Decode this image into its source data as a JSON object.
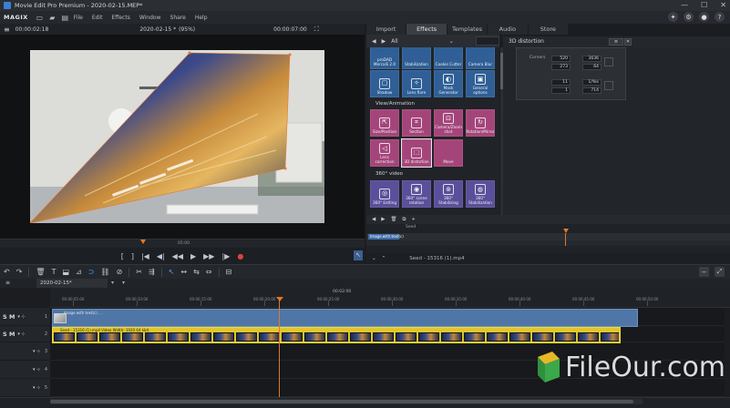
{
  "window": {
    "title": "Movie Edit Pro Premium - 2020-02-15.MEP*",
    "controls": [
      "—",
      "☐",
      "✕"
    ]
  },
  "menu": {
    "logo": "MAGIX",
    "items": [
      "File",
      "Edit",
      "Effects",
      "Window",
      "Share",
      "Help"
    ],
    "right_icons": [
      "magic-wand-icon",
      "gear-icon",
      "record-icon",
      "help-icon"
    ]
  },
  "preview": {
    "timecode_left": "00:00:02:18",
    "project_label": "2020-02-15 *",
    "zoom": "(95%)",
    "timecode_right": "00:00:07:00",
    "ruler_label": "05:00"
  },
  "panel_tabs": [
    "Import",
    "Effects",
    "Templates",
    "Audio",
    "Store"
  ],
  "active_tab": "Effects",
  "filter": {
    "label": "All"
  },
  "effects": {
    "row1": [
      {
        "name": "Shadow",
        "color": "#2f5f96",
        "icon": "shadow-icon"
      },
      {
        "name": "Lens flare",
        "color": "#2f5f96",
        "icon": "lens-flare-icon"
      },
      {
        "name": "Mask Generator",
        "color": "#2f5f96",
        "icon": "mask-icon"
      },
      {
        "name": "General options",
        "color": "#2f5f96",
        "icon": "options-icon"
      }
    ],
    "row0": [
      {
        "name": "proDAD Mercalli 2.0",
        "color": "#2f5f96"
      },
      {
        "name": "Stabilization",
        "color": "#2f5f96"
      },
      {
        "name": "Cookie Cutter",
        "color": "#2f5f96"
      },
      {
        "name": "Camera Blur",
        "color": "#2f5f96"
      }
    ],
    "category_view": "View/Animation",
    "row2": [
      {
        "name": "Size/Position",
        "color": "#a4457a",
        "icon": "size-position-icon"
      },
      {
        "name": "Section",
        "color": "#a4457a",
        "icon": "crop-icon"
      },
      {
        "name": "Camera/Zoom shot",
        "color": "#a4457a",
        "icon": "camera-icon"
      },
      {
        "name": "Rotation/Mirror",
        "color": "#a4457a",
        "icon": "rotate-icon"
      }
    ],
    "row3": [
      {
        "name": "Lens correction",
        "color": "#a4457a",
        "icon": "lens-icon"
      },
      {
        "name": "3D distortion",
        "color": "#a4457a",
        "icon": "distortion-icon",
        "selected": true
      },
      {
        "name": "Move",
        "color": "#a4457a",
        "icon": "move-icon"
      }
    ],
    "category_360": "360° video",
    "row4": [
      {
        "name": "360° Editing",
        "color": "#5a4f9a",
        "icon": "360-edit-icon"
      },
      {
        "name": "360° scene rotation",
        "color": "#5a4f9a",
        "icon": "360-rotate-icon"
      },
      {
        "name": "360° Stabilizing",
        "color": "#5a4f9a",
        "icon": "360-stab-icon"
      },
      {
        "name": "360° Stabilization",
        "color": "#5a4f9a",
        "icon": "360-stab2-icon"
      }
    ]
  },
  "distortion": {
    "title": "3D distortion",
    "corner_label": "Corners",
    "values": [
      "520",
      "3636",
      "273",
      "64",
      "11",
      "1/Yes",
      "1",
      "714"
    ]
  },
  "lower_strip": {
    "label": "Seed",
    "clip_label": "Image.with.text(c)",
    "footer_label": "Seed - 15316 (1).mp4"
  },
  "timeline": {
    "project_tab": "2020-02-15*",
    "ruler_top": "00:02:00",
    "ruler_marks": [
      "00:00:05:00",
      "00:00:10:00",
      "00:00:15:00",
      "00:00:20:00",
      "00:00:25:00",
      "00:00:30:00",
      "00:00:35:00",
      "00:00:40:00",
      "00:00:45:00",
      "00:00:50:00"
    ],
    "tracks": [
      {
        "sm": "S M",
        "num": "1"
      },
      {
        "sm": "S M",
        "num": "2"
      },
      {
        "sm": "",
        "num": "3"
      },
      {
        "sm": "",
        "num": "4"
      },
      {
        "sm": "",
        "num": "5"
      }
    ],
    "clip1_label": "Image with text(c) ...",
    "clip2_label": "Seed - 15316 (1).mp4  Video  Width: 1920  64 kbit"
  },
  "watermark": {
    "text": "FileOur.com"
  }
}
